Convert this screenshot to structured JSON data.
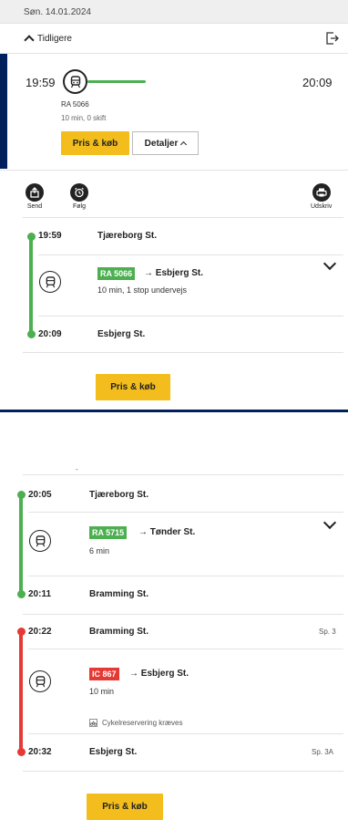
{
  "date": "Søn. 14.01.2024",
  "earlier_label": "Tidligere",
  "journey": {
    "departure": "19:59",
    "arrival": "20:09",
    "train": "RA 5066",
    "summary": "10 min, 0 skift",
    "buy_label": "Pris & køb",
    "details_label": "Detaljer"
  },
  "actions": [
    {
      "label": "Send",
      "icon": "share-icon"
    },
    {
      "label": "Følg",
      "icon": "alarm-clock-icon"
    },
    {
      "label": "Udskriv",
      "icon": "printer-icon"
    }
  ],
  "detail1": {
    "from_time": "19:59",
    "from_stop": "Tjæreborg St.",
    "train": "RA 5066",
    "direction": "→ Esbjerg St.",
    "info": "10 min, 1 stop undervejs",
    "to_time": "20:09",
    "to_stop": "Esbjerg St.",
    "buy_label": "Pris & køb"
  },
  "detail2": {
    "separator": "-",
    "leg1": {
      "from_time": "20:05",
      "from_stop": "Tjæreborg St.",
      "train": "RA 5715",
      "direction": "→ Tønder St.",
      "info": "6 min",
      "to_time": "20:11",
      "to_stop": "Bramming St."
    },
    "leg2": {
      "from_time": "20:22",
      "from_stop": "Bramming St.",
      "from_platform": "Sp. 3",
      "train": "IC 867",
      "direction": "→ Esbjerg St.",
      "info": "10 min",
      "note": "Cykelreservering kræves",
      "to_time": "20:32",
      "to_stop": "Esbjerg St.",
      "to_platform": "Sp. 3A"
    },
    "buy_label": "Pris & køb"
  },
  "colors": {
    "regional_green": "#4caf50",
    "intercity_red": "#e53935",
    "accent_yellow": "#f2bd1d",
    "navy": "#00205b"
  }
}
